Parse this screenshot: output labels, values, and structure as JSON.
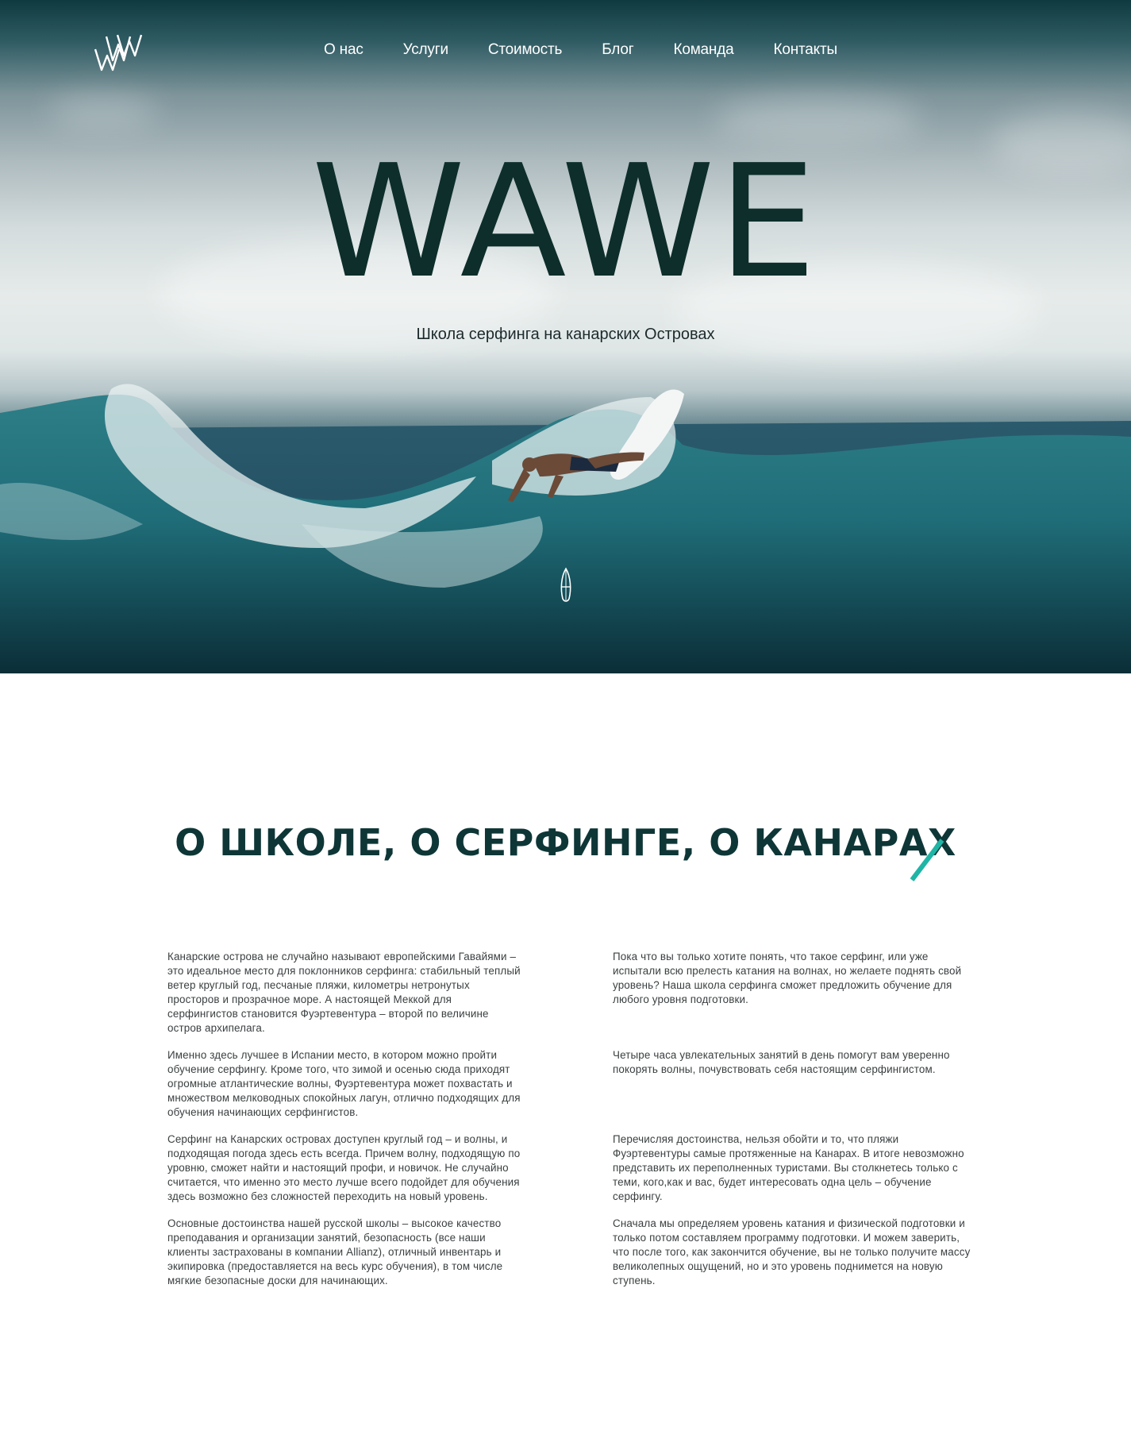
{
  "logo": {
    "icon": "wawe-logo-icon"
  },
  "nav": {
    "items": [
      "О нас",
      "Услуги",
      "Стоимость",
      "Блог",
      "Команда",
      "Контакты"
    ]
  },
  "hero": {
    "title": "WAWE",
    "subtitle": "Школа серфинга на канарских Островах",
    "scroll_icon": "surfboard-scroll-icon"
  },
  "about": {
    "title": "О ШКОЛЕ, О СЕРФИНГЕ, О КАНАРАХ",
    "accent_color": "#1fb5a6",
    "left": [
      "Канарские острова не случайно называют европейскими Гавайями – это идеальное место для поклонников серфинга: стабильный теплый ветер круглый год, песчаные пляжи, километры нетронутых просторов и прозрачное море. А настоящей Меккой для серфингистов становится Фуэртевентура – второй по величине остров архипелага.",
      "Именно здесь лучшее в Испании место, в котором можно пройти обучение серфингу. Кроме того, что зимой и осенью сюда приходят огромные атлантические волны, Фуэртевентура может похвастать и множеством мелководных спокойных лагун, отлично подходящих для обучения начинающих серфингистов.",
      "Серфинг на Канарских островах доступен круглый год – и волны, и подходящая погода здесь есть всегда. Причем волну, подходящую по уровню, сможет найти и настоящий профи, и новичок. Не случайно считается, что именно это место лучше всего подойдет для обучения здесь возможно без сложностей переходить на новый уровень.",
      "Основные достоинства нашей русской школы – высокое качество преподавания и организации занятий, безопасность (все наши клиенты застрахованы в компании Allianz), отличный инвентарь и экипировка (предоставляется на весь курс обучения), в том числе мягкие безопасные доски для начинающих."
    ],
    "right": [
      "Пока что вы только хотите понять, что такое серфинг, или уже испытали всю прелесть катания на волнах, но желаете поднять свой уровень? Наша школа серфинга сможет предложить обучение для любого уровня подготовки.",
      "Четыре часа увлекательных занятий в день помогут вам уверенно покорять волны, почувствовать себя настоящим серфингистом.",
      "Перечисляя достоинства, нельзя обойти и то, что пляжи Фуэртевентуры самые протяженные на Канарах. В итоге невозможно представить их переполненных туристами. Вы столкнетесь только с теми, кого,как и вас, будет интересовать одна цель – обучение серфингу.",
      "Сначала мы определяем уровень катания и физической подготовки и только потом составляем программу подготовки. И можем заверить, что после того, как закончится обучение, вы не только получите массу великолепных ощущений, но и это уровень поднимется на новую ступень."
    ]
  }
}
